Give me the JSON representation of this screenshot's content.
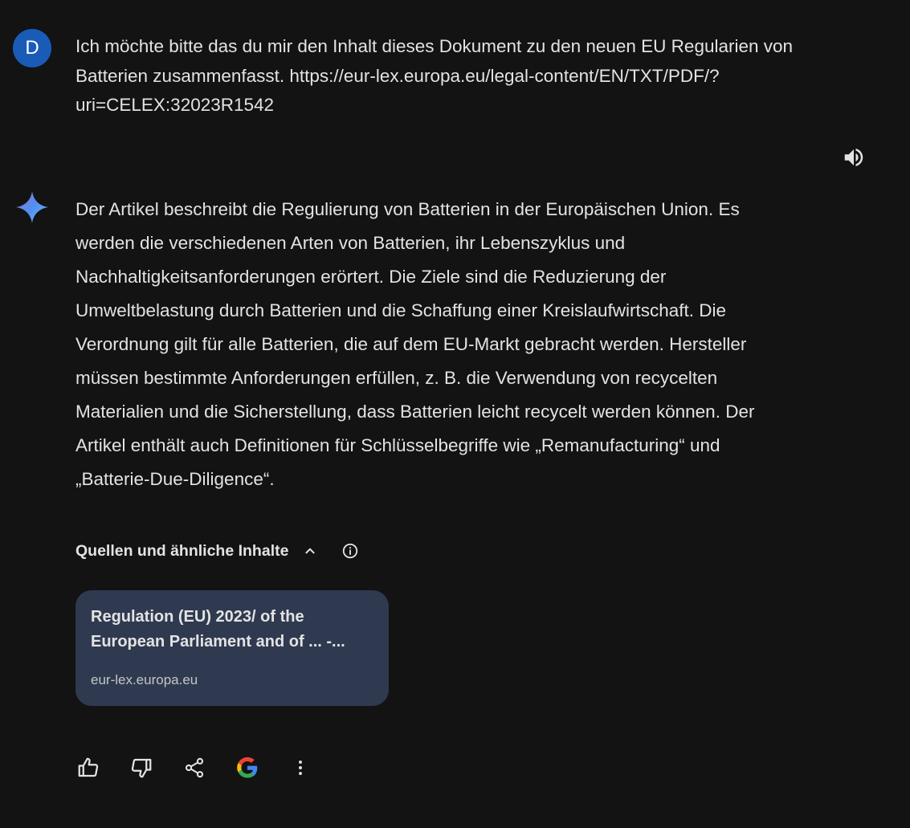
{
  "user": {
    "avatar_letter": "D",
    "message_lines": [
      "Ich möchte bitte das du mir den Inhalt dieses Dokument zu den neuen EU Regularien von",
      "Batterien zusammenfasst. https://eur-lex.europa.eu/legal-content/EN/TXT/PDF/?",
      "uri=CELEX:32023R1542"
    ]
  },
  "response": {
    "lines": [
      "Der Artikel beschreibt die Regulierung von Batterien in der Europäischen Union. Es",
      "werden die verschiedenen Arten von Batterien, ihr Lebenszyklus und",
      "Nachhaltigkeitsanforderungen erörtert. Die Ziele sind die Reduzierung der",
      "Umweltbelastung durch Batterien und die Schaffung einer Kreislaufwirtschaft. Die",
      "Verordnung gilt für alle Batterien, die auf dem EU-Markt gebracht werden. Hersteller",
      "müssen bestimmte Anforderungen erfüllen, z. B. die Verwendung von recycelten",
      "Materialien und die Sicherstellung, dass Batterien leicht recycelt werden können. Der",
      "Artikel enthält auch Definitionen für Schlüsselbegriffe wie „Remanufacturing“ und",
      "„Batterie-Due-Diligence“."
    ]
  },
  "sources": {
    "header": "Quellen und ähnliche Inhalte",
    "cards": [
      {
        "title_line1": "Regulation (EU) 2023/ of the",
        "title_line2": "European Parliament and of ... -...",
        "domain": "eur-lex.europa.eu"
      }
    ]
  },
  "icons": {
    "speaker": "volume-up-icon",
    "gemini": "gemini-sparkle-icon",
    "chevron": "chevron-up-icon",
    "info": "info-icon",
    "thumbs_up": "thumbs-up-icon",
    "thumbs_down": "thumbs-down-icon",
    "share": "share-icon",
    "google": "google-g-icon",
    "more": "more-vert-icon"
  },
  "colors": {
    "background": "#131314",
    "text": "#e3e3e3",
    "avatar": "#1a5bb8",
    "card": "#2f3a50",
    "muted": "#c4c7c5"
  }
}
